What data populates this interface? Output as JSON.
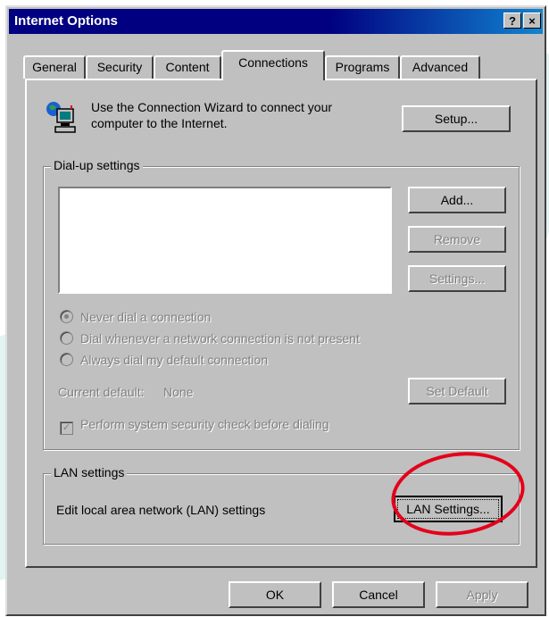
{
  "window": {
    "title": "Internet Options",
    "help_button": "?",
    "close_button": "×"
  },
  "tabs": [
    {
      "label": "General"
    },
    {
      "label": "Security"
    },
    {
      "label": "Content"
    },
    {
      "label": "Connections"
    },
    {
      "label": "Programs"
    },
    {
      "label": "Advanced"
    }
  ],
  "active_tab": "Connections",
  "connection_wizard": {
    "line1": "Use the Connection Wizard to connect your",
    "line2": "computer to the Internet.",
    "setup_button": "Setup..."
  },
  "dialup": {
    "group_label": "Dial-up settings",
    "add_button": "Add...",
    "remove_button": "Remove",
    "settings_button": "Settings...",
    "radio_options": [
      {
        "label": "Never dial a connection",
        "checked": true
      },
      {
        "label": "Dial whenever a network connection is not present",
        "checked": false
      },
      {
        "label": "Always dial my default connection",
        "checked": false
      }
    ],
    "current_default_label": "Current default:",
    "current_default_value": "None",
    "set_default_button": "Set Default",
    "security_check_label": "Perform system security check before dialing",
    "security_check_checked": true
  },
  "lan": {
    "group_label": "LAN settings",
    "description": "Edit local area network (LAN) settings",
    "lan_settings_button": "LAN Settings..."
  },
  "footer": {
    "ok_button": "OK",
    "cancel_button": "Cancel",
    "apply_button": "Apply"
  },
  "colors": {
    "title_bar": "#000080",
    "dialog_face": "#c0c0c0",
    "highlight_circle": "#e3001b"
  }
}
